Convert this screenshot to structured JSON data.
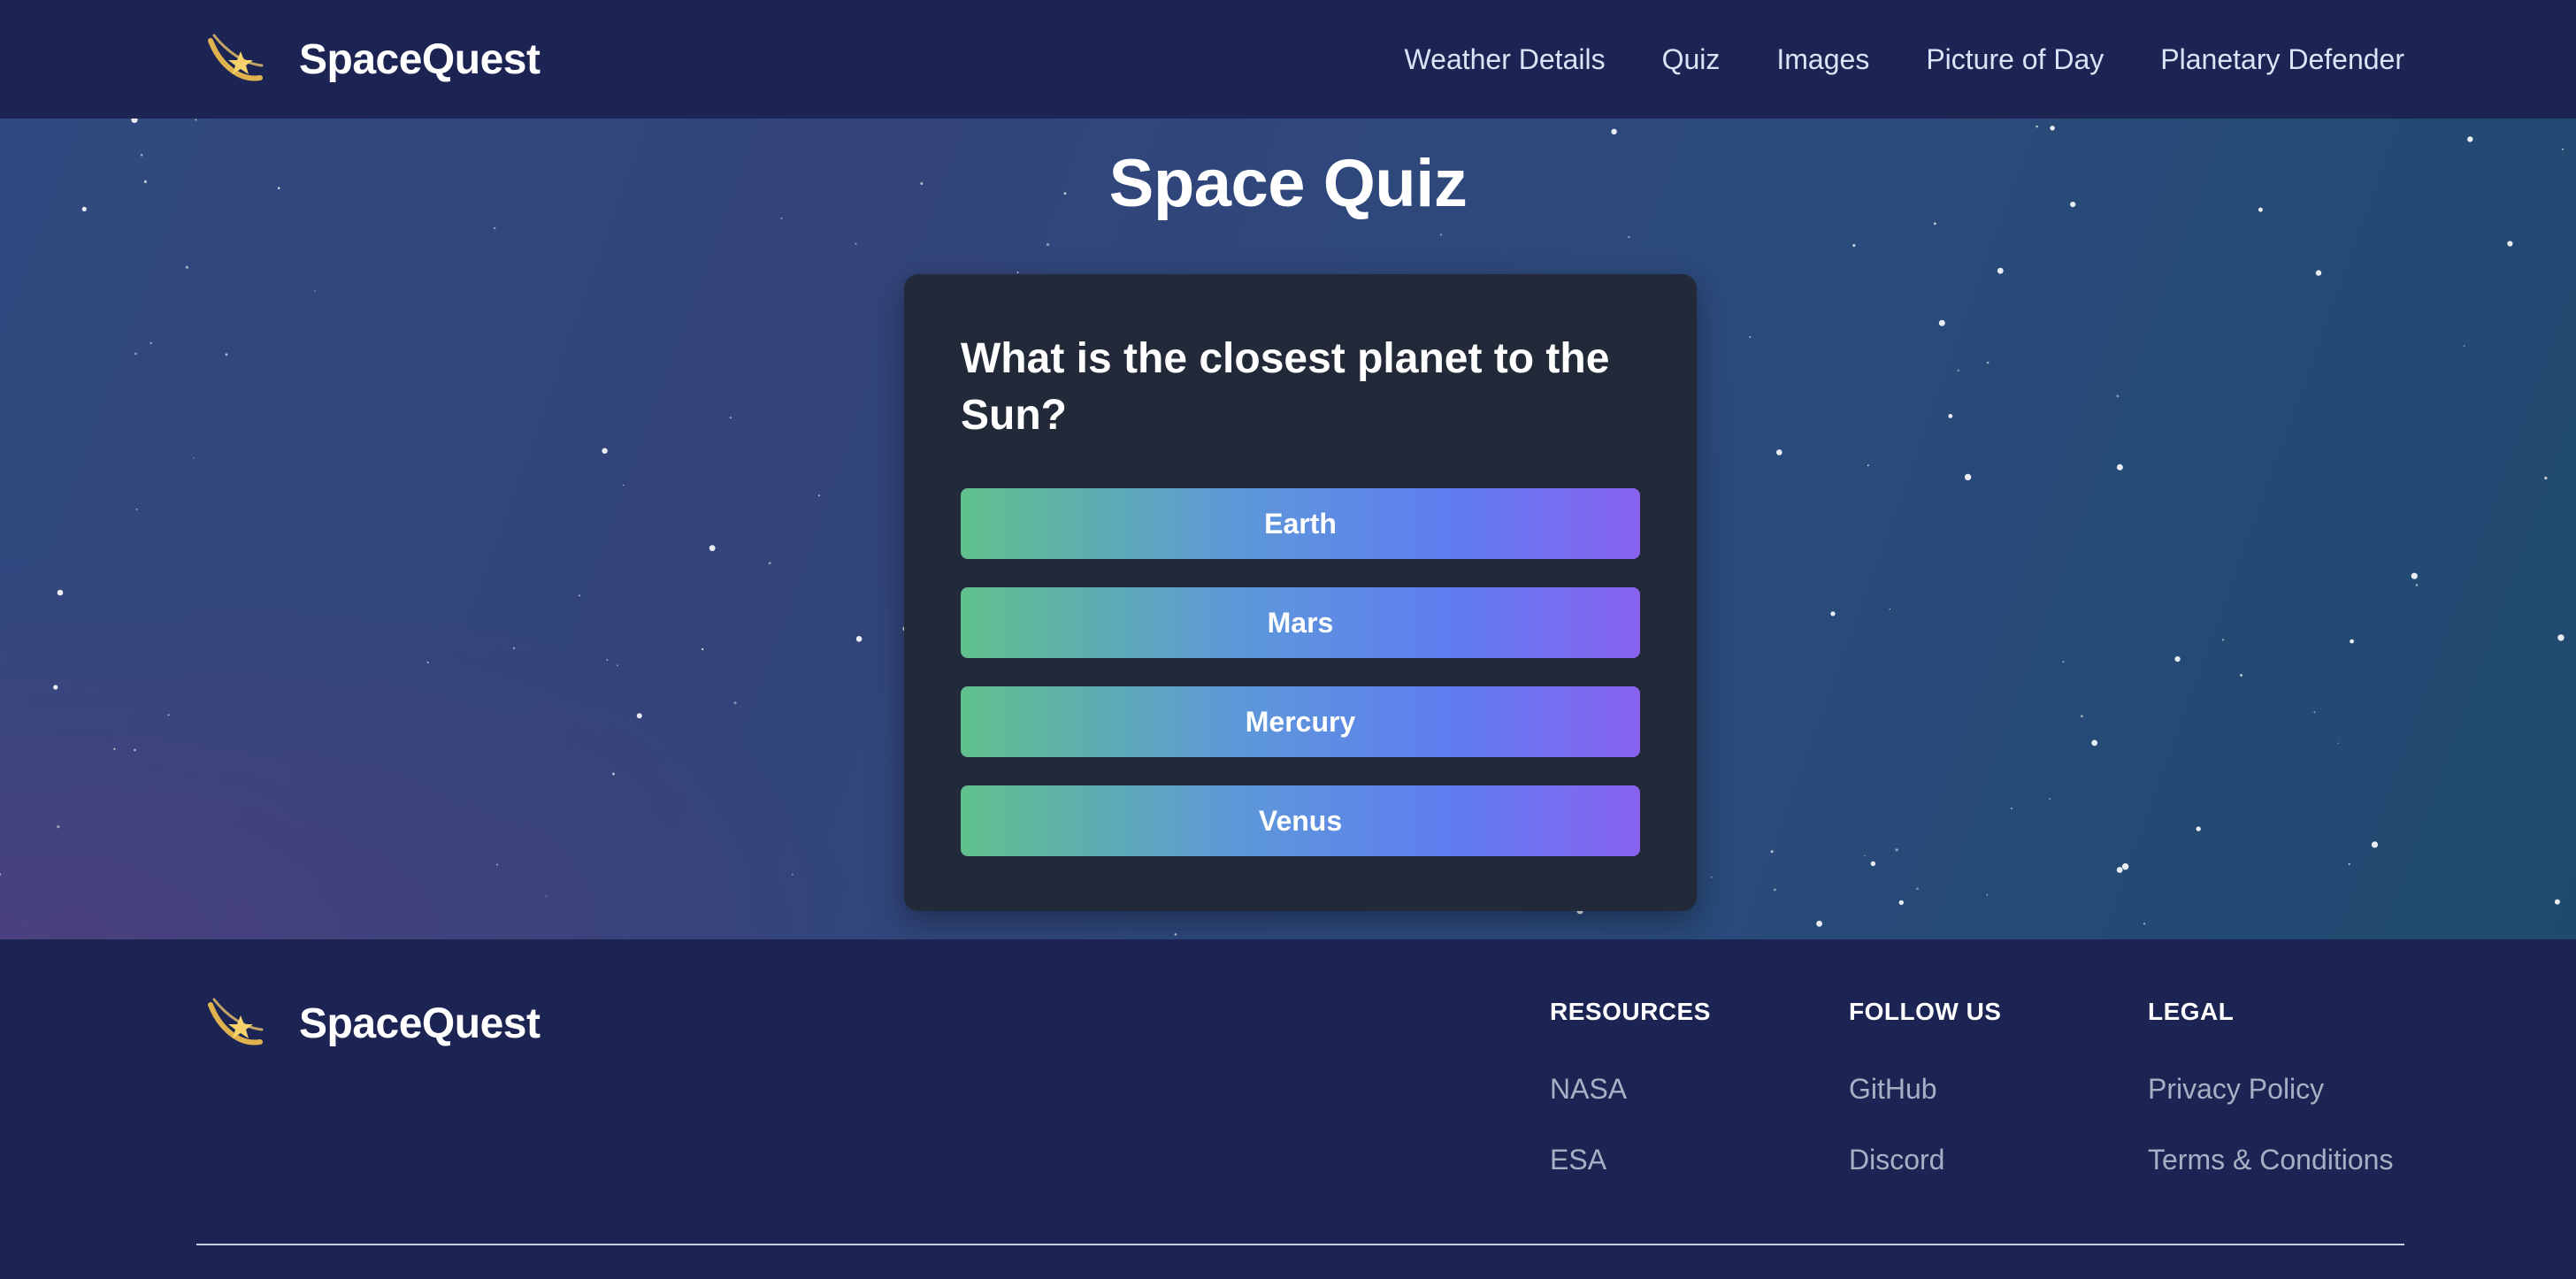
{
  "header": {
    "brand": "SpaceQuest",
    "nav": [
      {
        "label": "Weather Details"
      },
      {
        "label": "Quiz"
      },
      {
        "label": "Images"
      },
      {
        "label": "Picture of Day"
      },
      {
        "label": "Planetary Defender"
      }
    ]
  },
  "main": {
    "title": "Space Quiz",
    "quiz": {
      "question": "What is the closest planet to the Sun?",
      "answers": [
        "Earth",
        "Mars",
        "Mercury",
        "Venus"
      ]
    }
  },
  "footer": {
    "brand": "SpaceQuest",
    "columns": [
      {
        "heading": "RESOURCES",
        "links": [
          "NASA",
          "ESA"
        ]
      },
      {
        "heading": "FOLLOW US",
        "links": [
          "GitHub",
          "Discord"
        ]
      },
      {
        "heading": "LEGAL",
        "links": [
          "Privacy Policy",
          "Terms & Conditions"
        ]
      }
    ]
  },
  "icons": {
    "logo": "comet-icon"
  },
  "colors": {
    "header_bg": "#1b2452",
    "footer_bg": "#1c2453",
    "card_bg": "#222938",
    "button_gradient_start": "#60c18c",
    "button_gradient_end": "#8762ef"
  }
}
